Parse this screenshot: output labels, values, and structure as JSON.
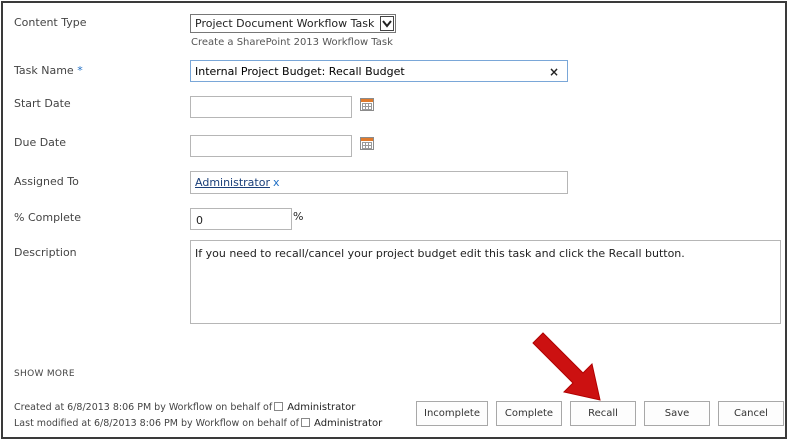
{
  "form": {
    "content_type": {
      "label": "Content Type",
      "value": "Project Document Workflow Task",
      "hint": "Create a SharePoint 2013 Workflow Task"
    },
    "task_name": {
      "label": "Task Name",
      "required_marker": "*",
      "value": "Internal Project Budget: Recall Budget",
      "clear_glyph": "×"
    },
    "start_date": {
      "label": "Start Date",
      "value": ""
    },
    "due_date": {
      "label": "Due Date",
      "value": ""
    },
    "assigned_to": {
      "label": "Assigned To",
      "person": "Administrator",
      "remove_glyph": "x"
    },
    "percent_complete": {
      "label": "% Complete",
      "value": "0",
      "unit": "%"
    },
    "description": {
      "label": "Description",
      "value": "If you need to recall/cancel your project budget edit this task and click the Recall button."
    }
  },
  "show_more": "SHOW MORE",
  "footer": {
    "created": {
      "prefix": "Created at 6/8/2013 8:06 PM  by Workflow on behalf of",
      "user": "Administrator"
    },
    "modified": {
      "prefix": "Last modified at 6/8/2013 8:06 PM  by Workflow on behalf of",
      "user": "Administrator"
    }
  },
  "buttons": {
    "incomplete": "Incomplete",
    "complete": "Complete",
    "recall": "Recall",
    "save": "Save",
    "cancel": "Cancel"
  },
  "colors": {
    "annotation_arrow": "#cc1111",
    "accent": "#1f6fc5",
    "calendar_header": "#e07a2c"
  },
  "icons": {
    "select": "chevron-down-icon",
    "date_picker": "calendar-icon",
    "clear": "close-icon",
    "annotation": "arrow-pointer-icon"
  }
}
